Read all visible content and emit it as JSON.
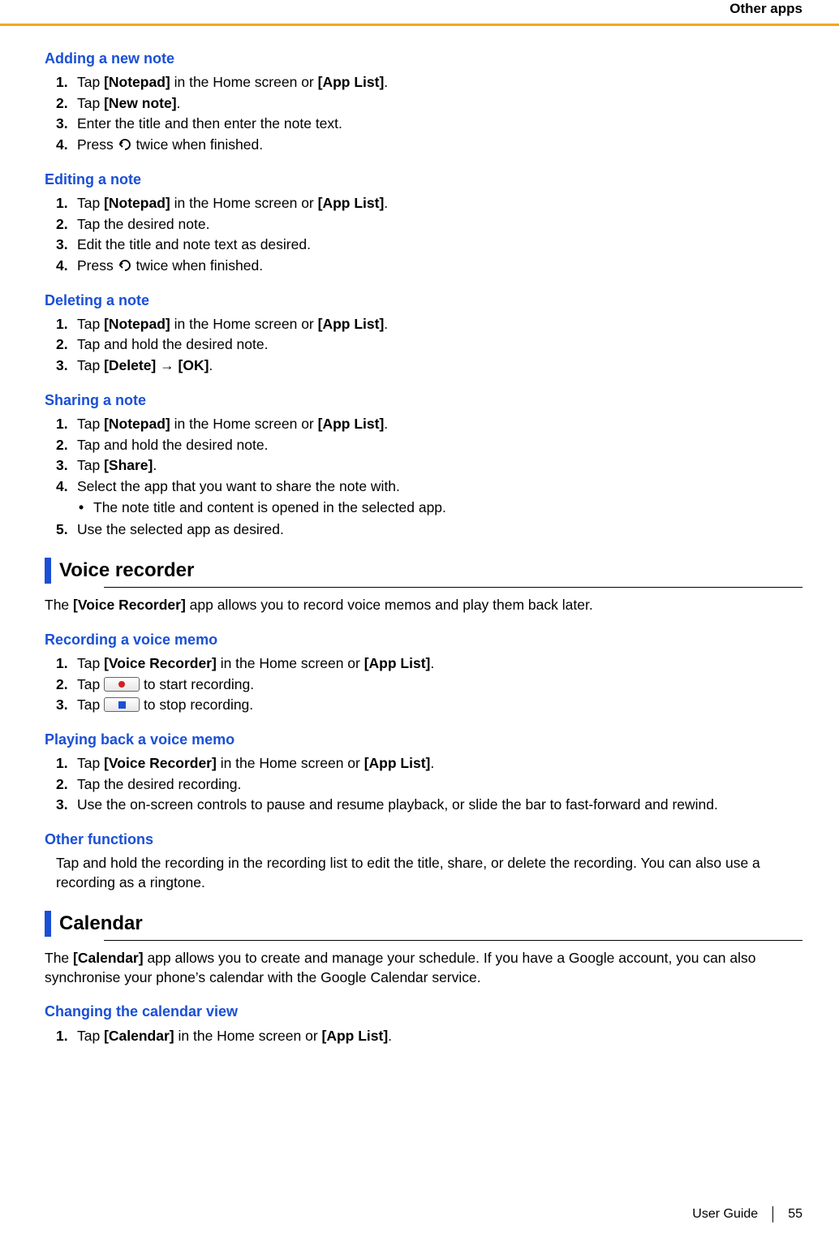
{
  "header": "Other apps",
  "footer": {
    "label": "User Guide",
    "page": "55"
  },
  "sections": {
    "adding": {
      "title": "Adding a new note",
      "s1a": "Tap ",
      "s1b": "[Notepad]",
      "s1c": " in the Home screen or ",
      "s1d": "[App List]",
      "s1e": ".",
      "s2a": "Tap ",
      "s2b": "[New note]",
      "s2c": ".",
      "s3": "Enter the title and then enter the note text.",
      "s4a": "Press ",
      "s4b": " twice when finished."
    },
    "editing": {
      "title": "Editing a note",
      "s1a": "Tap ",
      "s1b": "[Notepad]",
      "s1c": " in the Home screen or ",
      "s1d": "[App List]",
      "s1e": ".",
      "s2": "Tap the desired note.",
      "s3": "Edit the title and note text as desired.",
      "s4a": "Press ",
      "s4b": " twice when finished."
    },
    "deleting": {
      "title": "Deleting a note",
      "s1a": "Tap ",
      "s1b": "[Notepad]",
      "s1c": " in the Home screen or ",
      "s1d": "[App List]",
      "s1e": ".",
      "s2": "Tap and hold the desired note.",
      "s3a": "Tap ",
      "s3b": "[Delete]",
      "s3c": " → ",
      "s3d": "[OK]",
      "s3e": "."
    },
    "sharing": {
      "title": "Sharing a note",
      "s1a": "Tap ",
      "s1b": "[Notepad]",
      "s1c": " in the Home screen or ",
      "s1d": "[App List]",
      "s1e": ".",
      "s2": "Tap and hold the desired note.",
      "s3a": "Tap ",
      "s3b": "[Share]",
      "s3c": ".",
      "s4": "Select the app that you want to share the note with.",
      "bullet": "The note title and content is opened in the selected app.",
      "s5": "Use the selected app as desired."
    },
    "voice": {
      "title": "Voice recorder",
      "intro_a": "The ",
      "intro_b": "[Voice Recorder]",
      "intro_c": " app allows you to record voice memos and play them back later."
    },
    "recording": {
      "title": "Recording a voice memo",
      "s1a": "Tap ",
      "s1b": "[Voice Recorder]",
      "s1c": " in the Home screen or ",
      "s1d": "[App List]",
      "s1e": ".",
      "s2a": "Tap ",
      "s2b": " to start recording.",
      "s3a": "Tap ",
      "s3b": " to stop recording."
    },
    "playback": {
      "title": "Playing back a voice memo",
      "s1a": "Tap ",
      "s1b": "[Voice Recorder]",
      "s1c": " in the Home screen or ",
      "s1d": "[App List]",
      "s1e": ".",
      "s2": "Tap the desired recording.",
      "s3": "Use the on-screen controls to pause and resume playback, or slide the bar to fast-forward and rewind."
    },
    "other": {
      "title": "Other functions",
      "body": "Tap and hold the recording in the recording list to edit the title, share, or delete the recording. You can also use a recording as a ringtone."
    },
    "calendar": {
      "title": "Calendar",
      "intro_a": "The ",
      "intro_b": "[Calendar]",
      "intro_c": " app allows you to create and manage your schedule. If you have a Google account, you can also synchronise your phone’s calendar with the Google Calendar service."
    },
    "calview": {
      "title": "Changing the calendar view",
      "s1a": "Tap ",
      "s1b": "[Calendar]",
      "s1c": " in the Home screen or ",
      "s1d": "[App List]",
      "s1e": "."
    }
  }
}
